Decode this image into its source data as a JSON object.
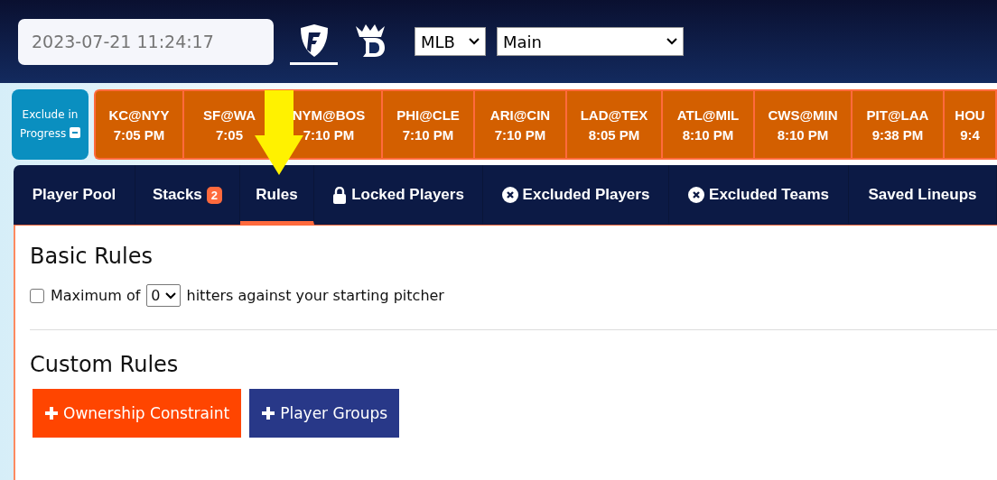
{
  "header": {
    "datetime": {
      "placeholder": "2023-07-21 11:24:17"
    },
    "sites": [
      {
        "kind": "fanduel",
        "selected": true
      },
      {
        "kind": "draftkings",
        "selected": false
      }
    ],
    "sport_select": {
      "value": "MLB"
    },
    "slate_select": {
      "value": "Main"
    }
  },
  "games_strip": {
    "exclude_button": {
      "label": "Exclude in Progress"
    },
    "games": [
      {
        "matchup": "KC@NYY",
        "time": "7:05 PM"
      },
      {
        "matchup": "SF@WA",
        "time": "7:05"
      },
      {
        "matchup": "NYM@BOS",
        "time": "7:10 PM"
      },
      {
        "matchup": "PHI@CLE",
        "time": "7:10 PM"
      },
      {
        "matchup": "ARI@CIN",
        "time": "7:10 PM"
      },
      {
        "matchup": "LAD@TEX",
        "time": "8:05 PM"
      },
      {
        "matchup": "ATL@MIL",
        "time": "8:10 PM"
      },
      {
        "matchup": "CWS@MIN",
        "time": "8:10 PM"
      },
      {
        "matchup": "PIT@LAA",
        "time": "9:38 PM"
      },
      {
        "matchup": "HOU",
        "time": "9:4"
      }
    ]
  },
  "tabs": [
    {
      "label": "Player Pool",
      "selected": false,
      "kind": "plain"
    },
    {
      "label": "Stacks",
      "selected": false,
      "kind": "plain",
      "badge": "2"
    },
    {
      "label": "Rules",
      "selected": true,
      "kind": "plain"
    },
    {
      "label": "Locked Players",
      "selected": false,
      "kind": "locked"
    },
    {
      "label": "Excluded Players",
      "selected": false,
      "kind": "excluded"
    },
    {
      "label": "Excluded Teams",
      "selected": false,
      "kind": "excluded"
    },
    {
      "label": "Saved Lineups",
      "selected": false,
      "kind": "plain"
    }
  ],
  "basic_rules": {
    "title": "Basic Rules",
    "rule": {
      "checked": false,
      "before": "Maximum of",
      "value": "0",
      "after": "hitters against your starting pitcher"
    }
  },
  "custom_rules": {
    "title": "Custom Rules",
    "buttons": [
      {
        "label": "Ownership Constraint",
        "kind": "orange"
      },
      {
        "label": "Player Groups",
        "kind": "navy"
      }
    ]
  },
  "annotation": {
    "kind": "arrow"
  }
}
